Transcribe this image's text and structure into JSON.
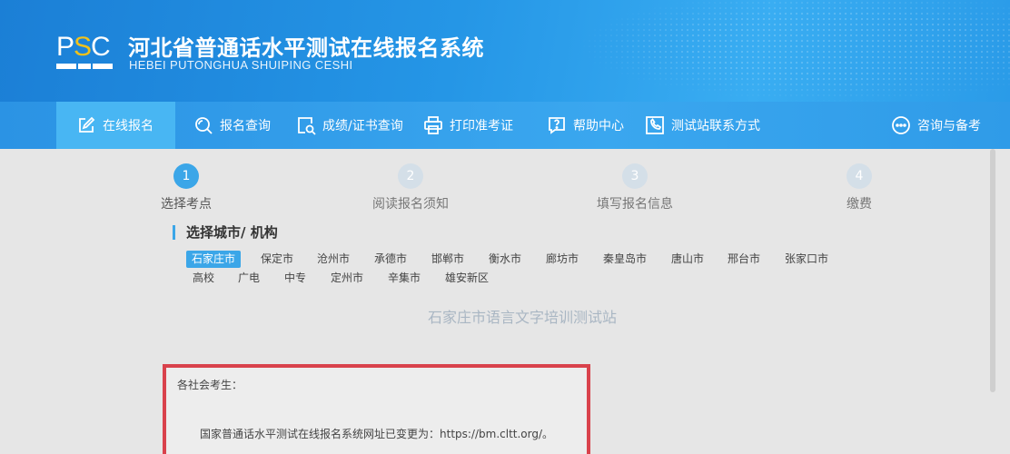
{
  "header": {
    "logo_prefix": "P",
    "logo_s": "S",
    "logo_suffix": "C",
    "title": "河北省普通话水平测试在线报名系统",
    "subtitle": "HEBEI PUTONGHUA SHUIPING CESHI"
  },
  "nav": {
    "items": [
      {
        "label": "在线报名",
        "icon": "edit-icon",
        "active": true
      },
      {
        "label": "报名查询",
        "icon": "search-icon"
      },
      {
        "label": "成绩/证书查询",
        "icon": "certificate-search-icon"
      },
      {
        "label": "打印准考证",
        "icon": "printer-icon"
      },
      {
        "label": "帮助中心",
        "icon": "help-icon"
      },
      {
        "label": "测试站联系方式",
        "icon": "phone-icon"
      },
      {
        "label": "咨询与备考",
        "icon": "chat-icon"
      }
    ]
  },
  "steps": [
    {
      "num": "1",
      "label": "选择考点",
      "active": true
    },
    {
      "num": "2",
      "label": "阅读报名须知"
    },
    {
      "num": "3",
      "label": "填写报名信息"
    },
    {
      "num": "4",
      "label": "缴费"
    }
  ],
  "section": {
    "title": "选择城市/ 机构"
  },
  "cities_row1": [
    "石家庄市",
    "保定市",
    "沧州市",
    "承德市",
    "邯郸市",
    "衡水市",
    "廊坊市",
    "秦皇岛市",
    "唐山市",
    "邢台市",
    "张家口市"
  ],
  "cities_row2": [
    "高校",
    "广电",
    "中专",
    "定州市",
    "辛集市",
    "雄安新区"
  ],
  "selected_city": "石家庄市",
  "station": {
    "name": "石家庄市语言文字培训测试站"
  },
  "notice": {
    "greeting": "各社会考生：",
    "message": "国家普通话水平测试在线报名系统网址已变更为：https://bm.cltt.org/。"
  },
  "colors": {
    "accent": "#3ba6e8",
    "header": "#1f8ae0",
    "notice_border": "#d9424c"
  }
}
